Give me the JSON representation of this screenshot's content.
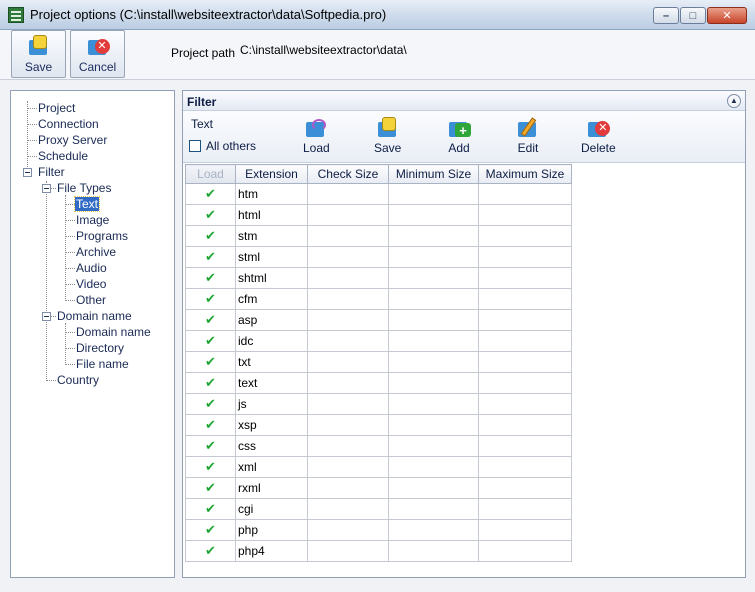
{
  "window": {
    "title": "Project options (C:\\install\\websiteextractor\\data\\Softpedia.pro)"
  },
  "toolbar": {
    "save_label": "Save",
    "cancel_label": "Cancel",
    "project_path_label": "Project path",
    "project_path_value": "C:\\install\\websiteextractor\\data\\"
  },
  "tree": {
    "project": "Project",
    "connection": "Connection",
    "proxy_server": "Proxy Server",
    "schedule": "Schedule",
    "filter": "Filter",
    "file_types": "File Types",
    "text": "Text",
    "image": "Image",
    "programs": "Programs",
    "archive": "Archive",
    "audio": "Audio",
    "video": "Video",
    "other": "Other",
    "domain_name": "Domain name",
    "domain_name_child": "Domain name",
    "directory": "Directory",
    "file_name": "File name",
    "country": "Country"
  },
  "filter": {
    "header": "Filter",
    "section_label": "Text",
    "all_others_label": "All others",
    "load_label": "Load",
    "save_label": "Save",
    "add_label": "Add",
    "edit_label": "Edit",
    "delete_label": "Delete",
    "columns": {
      "load": "Load",
      "extension": "Extension",
      "check_size": "Check Size",
      "minimum_size": "Minimum Size",
      "maximum_size": "Maximum Size"
    },
    "check_mark": "✔",
    "rows": [
      "htm",
      "html",
      "stm",
      "stml",
      "shtml",
      "cfm",
      "asp",
      "idc",
      "txt",
      "text",
      "js",
      "xsp",
      "css",
      "xml",
      "rxml",
      "cgi",
      "php",
      "php4"
    ]
  },
  "icons": {
    "save": "save-icon",
    "cancel": "cancel-icon",
    "load": "load-icon",
    "add": "add-icon",
    "edit": "edit-icon",
    "delete": "delete-icon"
  },
  "colors": {
    "selection": "#316ac5",
    "check": "#1fa533"
  }
}
